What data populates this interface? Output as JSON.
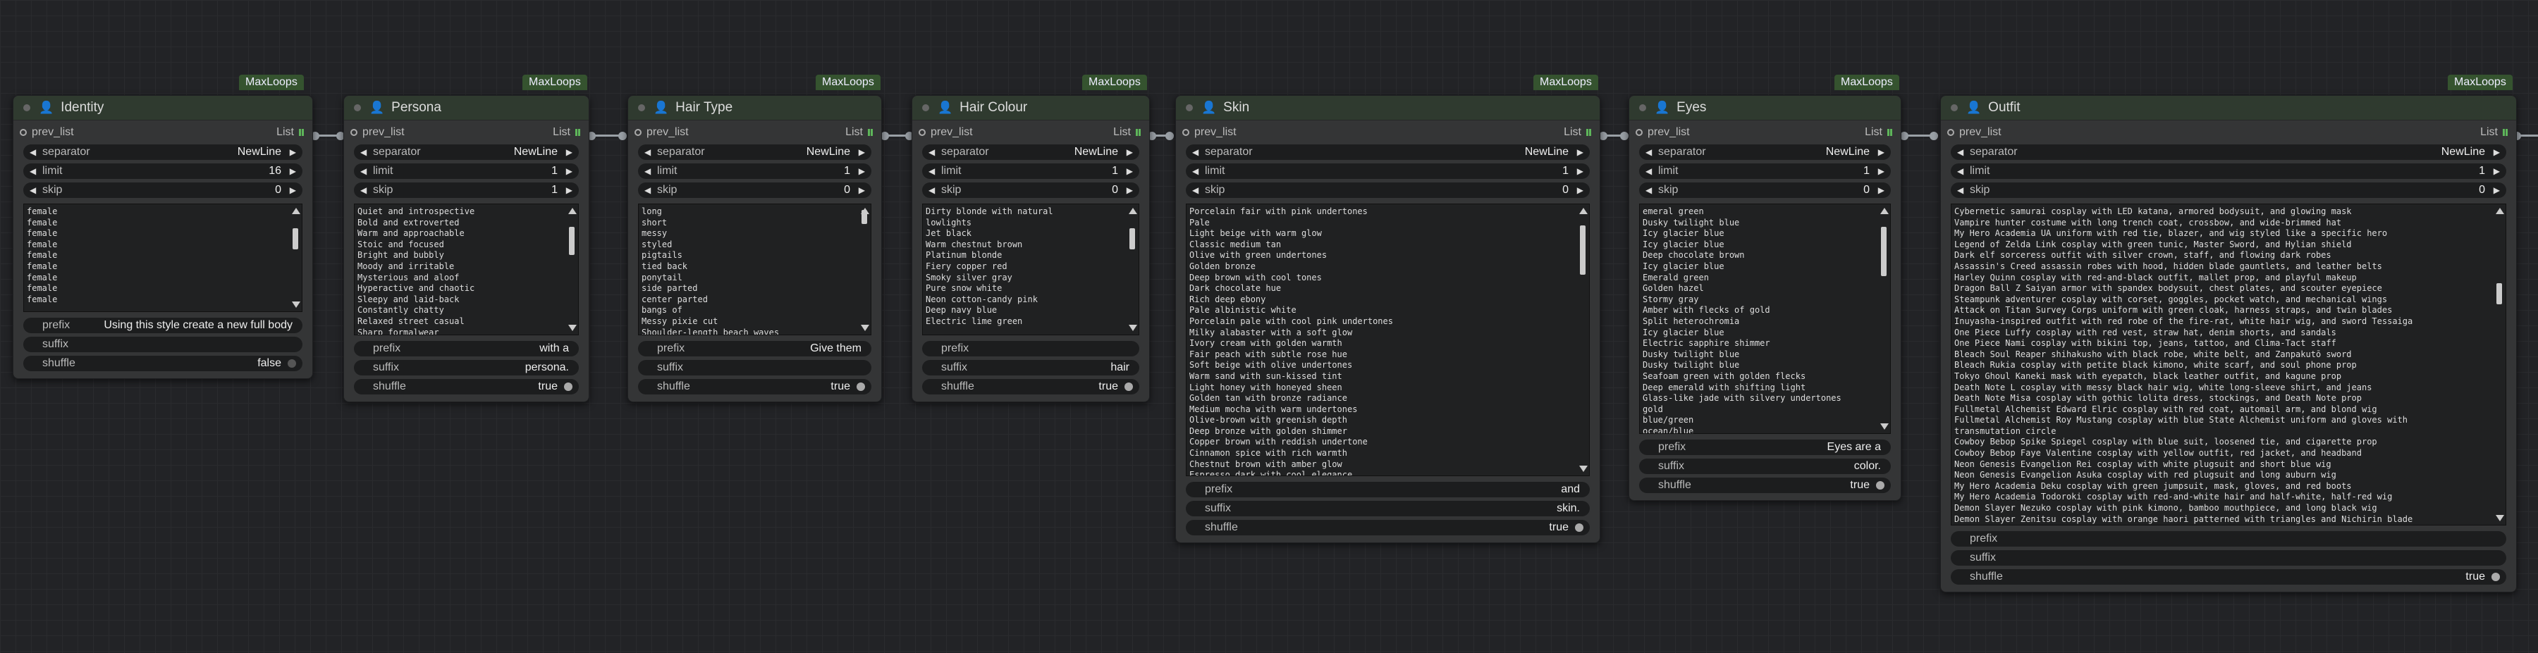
{
  "badge_text": "MaxLoops",
  "labels": {
    "prev_list": "prev_list",
    "list": "List",
    "separator": "separator",
    "limit": "limit",
    "skip": "skip",
    "prefix": "prefix",
    "suffix": "suffix",
    "shuffle": "shuffle"
  },
  "nodes": [
    {
      "title": "Identity",
      "separator": "NewLine",
      "limit": "16",
      "skip": "0",
      "items": [
        "female",
        "female",
        "female",
        "female",
        "female",
        "female",
        "female",
        "female",
        "female"
      ],
      "prefix": "Using this style create a new full body",
      "suffix": "",
      "shuffle": "false"
    },
    {
      "title": "Persona",
      "separator": "NewLine",
      "limit": "1",
      "skip": "1",
      "items": [
        "Quiet and introspective",
        "Bold and extroverted",
        "Warm and approachable",
        "Stoic and focused",
        "Bright and bubbly",
        "Moody and irritable",
        "Mysterious and aloof",
        "Hyperactive and chaotic",
        "Sleepy and laid-back",
        "Constantly chatty",
        "Relaxed street casual",
        "Sharp formalwear"
      ],
      "prefix": "with a",
      "suffix": "persona.",
      "shuffle": "true"
    },
    {
      "title": "Hair Type",
      "separator": "NewLine",
      "limit": "1",
      "skip": "0",
      "items": [
        "long",
        "short",
        "messy",
        "styled",
        "pigtails",
        "tied back",
        "ponytail",
        "side parted",
        "center parted",
        "bangs of",
        "Messy pixie cut",
        "Shoulder-length beach waves"
      ],
      "prefix": "Give them",
      "suffix": "",
      "shuffle": "true"
    },
    {
      "title": "Hair Colour",
      "separator": "NewLine",
      "limit": "1",
      "skip": "0",
      "items": [
        "Dirty blonde with natural",
        "lowlights",
        "Jet black",
        "Warm chestnut brown",
        "Platinum blonde",
        "Fiery copper red",
        "Smoky silver gray",
        "Pure snow white",
        "Neon cotton-candy pink",
        "Deep navy blue",
        "Electric lime green"
      ],
      "prefix": "",
      "suffix": "hair",
      "shuffle": "true"
    },
    {
      "title": "Skin",
      "separator": "NewLine",
      "limit": "1",
      "skip": "0",
      "items": [
        "Porcelain fair with pink undertones",
        "Pale",
        "Light beige with warm glow",
        "Classic medium tan",
        "Olive with green undertones",
        "Golden bronze",
        "Deep brown with cool tones",
        "Dark chocolate hue",
        "Rich deep ebony",
        "Pale albinistic white",
        "Porcelain pale with cool pink undertones",
        "Milky alabaster with a soft glow",
        "Ivory cream with golden warmth",
        "Fair peach with subtle rose hue",
        "Soft beige with olive undertones",
        "Warm sand with sun-kissed tint",
        "Light honey with honeyed sheen",
        "Golden tan with bronze radiance",
        "Medium mocha with warm undertones",
        "Olive-brown with greenish depth",
        "Deep bronze with golden shimmer",
        "Copper brown with reddish undertone",
        "Cinnamon spice with rich warmth",
        "Chestnut brown with amber glow",
        "Espresso dark with cool elegance"
      ],
      "prefix": "and",
      "suffix": "skin.",
      "shuffle": "true"
    },
    {
      "title": "Eyes",
      "separator": "NewLine",
      "limit": "1",
      "skip": "0",
      "items": [
        "emeral green",
        "Dusky twilight blue",
        "Icy glacier blue",
        "Icy glacier blue",
        "Deep chocolate brown",
        "Icy glacier blue",
        "Emerald green",
        "Golden hazel",
        "Stormy gray",
        "Amber with flecks of gold",
        "Split heterochromia",
        "Icy glacier blue",
        "Electric sapphire shimmer",
        "Dusky twilight blue",
        "Dusky twilight blue",
        "Seafoam green with golden flecks",
        "Deep emerald with shifting light",
        "Glass-like jade with silvery undertones",
        "gold",
        "blue/green",
        "ocean/blue"
      ],
      "prefix": "Eyes are a",
      "suffix": "color.",
      "shuffle": "true"
    },
    {
      "title": "Outfit",
      "separator": "NewLine",
      "limit": "1",
      "skip": "0",
      "items": [
        "Cybernetic samurai cosplay with LED katana, armored bodysuit, and glowing mask",
        "Vampire hunter costume with long trench coat, crossbow, and wide-brimmed hat",
        "My Hero Academia UA uniform with red tie, blazer, and wig styled like a specific hero",
        "Legend of Zelda Link cosplay with green tunic, Master Sword, and Hylian shield",
        "Dark elf sorceress outfit with silver crown, staff, and flowing dark robes",
        "Assassin's Creed assassin robes with hood, hidden blade gauntlets, and leather belts",
        "Harley Quinn cosplay with red-and-black outfit, mallet prop, and playful makeup",
        "Dragon Ball Z Saiyan armor with spandex bodysuit, chest plates, and scouter eyepiece",
        "Steampunk adventurer cosplay with corset, goggles, pocket watch, and mechanical wings",
        "Attack on Titan Survey Corps uniform with green cloak, harness straps, and twin blades",
        "Inuyasha-inspired outfit with red robe of the fire-rat, white hair wig, and sword Tessaiga",
        "One Piece Luffy cosplay with red vest, straw hat, denim shorts, and sandals",
        "One Piece Nami cosplay with bikini top, jeans, tattoo, and Clima-Tact staff",
        "Bleach Soul Reaper shihakusho with black robe, white belt, and Zanpakutō sword",
        "Bleach Rukia cosplay with petite black kimono, white scarf, and soul phone prop",
        "Tokyo Ghoul Kaneki mask with eyepatch, black leather outfit, and kagune prop",
        "Death Note L cosplay with messy black hair wig, white long-sleeve shirt, and jeans",
        "Death Note Misa cosplay with gothic lolita dress, stockings, and Death Note prop",
        "Fullmetal Alchemist Edward Elric cosplay with red coat, automail arm, and blond wig",
        "Fullmetal Alchemist Roy Mustang cosplay with blue State Alchemist uniform and gloves with",
        "transmutation circle",
        "Cowboy Bebop Spike Spiegel cosplay with blue suit, loosened tie, and cigarette prop",
        "Cowboy Bebop Faye Valentine cosplay with yellow outfit, red jacket, and headband",
        "Neon Genesis Evangelion Rei cosplay with white plugsuit and short blue wig",
        "Neon Genesis Evangelion Asuka cosplay with red plugsuit and long auburn wig",
        "My Hero Academia Deku cosplay with green jumpsuit, mask, gloves, and red boots",
        "My Hero Academia Todoroki cosplay with red-and-white hair and half-white, half-red wig",
        "Demon Slayer Nezuko cosplay with pink kimono, bamboo mouthpiece, and long black wig",
        "Demon Slayer Zenitsu cosplay with orange haori patterned with triangles and Nichirin blade"
      ],
      "prefix": "",
      "suffix": "",
      "shuffle": "true"
    }
  ]
}
